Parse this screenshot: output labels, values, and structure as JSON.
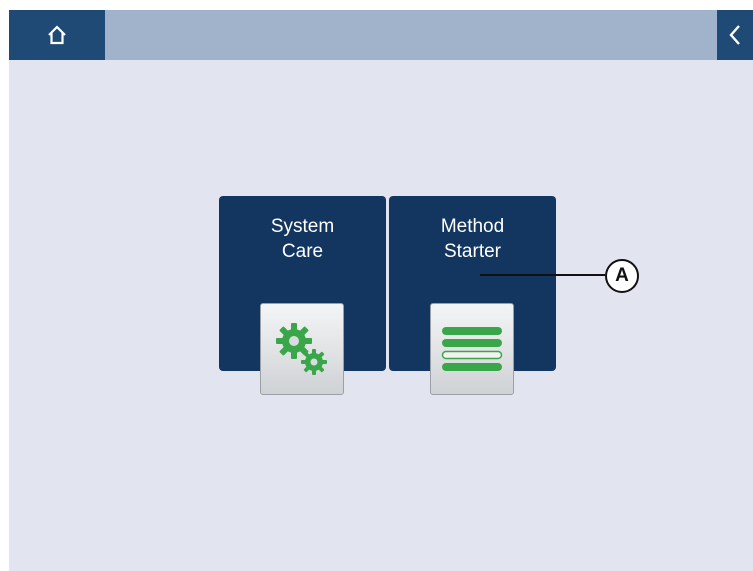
{
  "topbar": {
    "home_icon": "home-icon",
    "back_icon": "chevron-left-icon",
    "colors": {
      "bar": "#a1b2cb",
      "button": "#1f4a76"
    }
  },
  "tiles": [
    {
      "label": "System\nCare",
      "icon": "gears-icon"
    },
    {
      "label": "Method\nStarter",
      "icon": "list-icon"
    }
  ],
  "callout": {
    "label": "A"
  },
  "colors": {
    "screen_bg": "#e2e5f0",
    "tile_bg": "#12365f",
    "icon_green": "#3aa64a"
  }
}
